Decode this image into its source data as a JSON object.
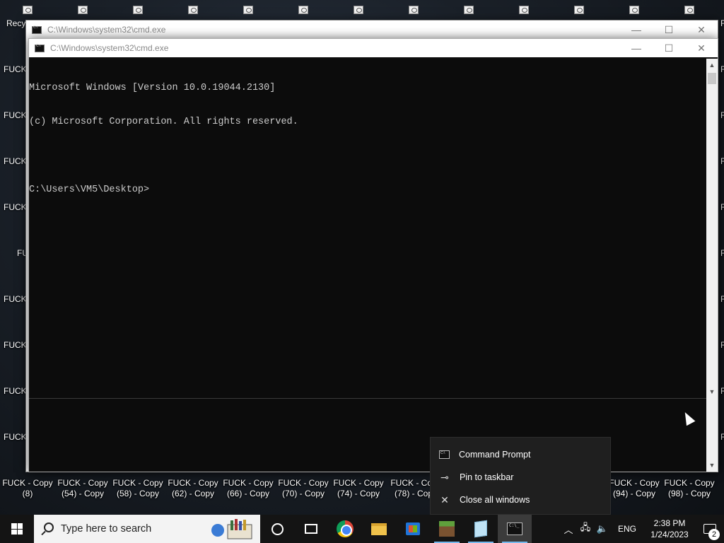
{
  "desktop": {
    "icon_caption": "FUCK - Copy",
    "top_left_label": "Recy",
    "left_labels": [
      "FUCK",
      "FUCK",
      "FUCK",
      "FUCK",
      "FU",
      "FUCK",
      "FUCK",
      "FUCK",
      "FUCK"
    ],
    "right_labels": [
      "F",
      "F",
      "F",
      "F",
      "F",
      "F",
      "F",
      "F",
      "F",
      "F"
    ],
    "bottom_icons": [
      {
        "line1": "FUCK - Copy",
        "line2": "(8)"
      },
      {
        "line1": "FUCK - Copy",
        "line2": "(54) - Copy"
      },
      {
        "line1": "FUCK - Copy",
        "line2": "(58) - Copy"
      },
      {
        "line1": "FUCK - Copy",
        "line2": "(62) - Copy"
      },
      {
        "line1": "FUCK - Copy",
        "line2": "(66) - Copy"
      },
      {
        "line1": "FUCK - Copy",
        "line2": "(70) - Copy"
      },
      {
        "line1": "FUCK - Copy",
        "line2": "(74) - Copy"
      },
      {
        "line1": "FUCK - Cop",
        "line2": "(78) - Cop"
      },
      {
        "line1": "FUCK - Copy",
        "line2": "(94) - Copy"
      },
      {
        "line1": "FUCK - Copy",
        "line2": "(98) - Copy"
      }
    ]
  },
  "window_back": {
    "title": "C:\\Windows\\system32\\cmd.exe",
    "minimize": "—",
    "maximize": "☐",
    "close": "✕"
  },
  "window_front": {
    "title": "C:\\Windows\\system32\\cmd.exe",
    "minimize": "—",
    "maximize": "☐",
    "close": "✕",
    "console_lines": [
      "Microsoft Windows [Version 10.0.19044.2130]",
      "(c) Microsoft Corporation. All rights reserved.",
      "",
      "C:\\Users\\VM5\\Desktop>"
    ]
  },
  "jumplist": {
    "items": [
      {
        "label": "Command Prompt",
        "icon": "cmd-icon"
      },
      {
        "label": "Pin to taskbar",
        "icon": "pin-icon"
      },
      {
        "label": "Close all windows",
        "icon": "close-icon"
      }
    ]
  },
  "taskbar": {
    "search_placeholder": "Type here to search",
    "apps": [
      "cortana",
      "task-view",
      "chrome",
      "file-explorer",
      "microsoft-store",
      "minecraft",
      "notepad",
      "command-prompt"
    ],
    "tray": {
      "language": "ENG",
      "time": "2:38 PM",
      "date": "1/24/2023",
      "notification_count": "2"
    }
  },
  "colors": {
    "console_bg": "#0c0c0c",
    "console_text": "#cccccc",
    "taskbar_bg": "#141414",
    "jumplist_bg": "#1f1f1f",
    "active_underline": "#76b9ed"
  }
}
